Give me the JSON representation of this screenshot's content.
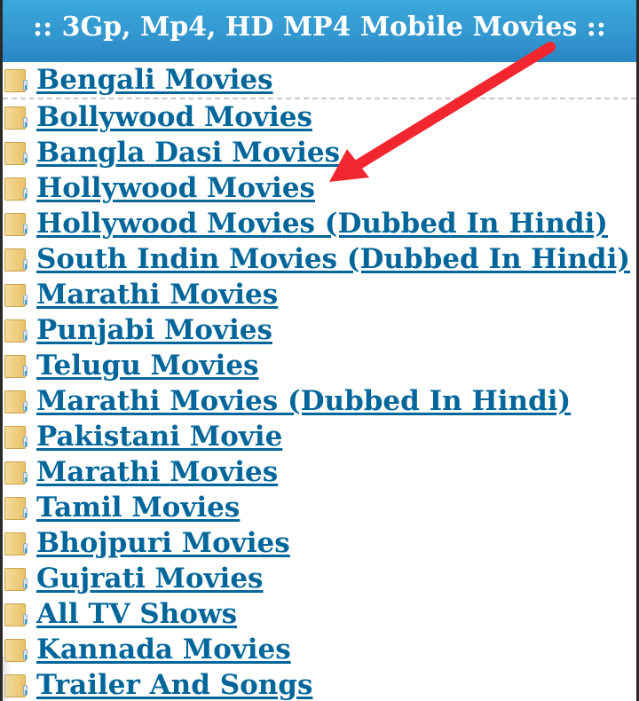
{
  "header": {
    "title": ":: 3Gp, Mp4, HD MP4 Mobile Movies ::"
  },
  "categories": [
    {
      "label": "Bengali Movies",
      "icon": "folder-icon"
    },
    {
      "label": "Bollywood Movies",
      "icon": "folder-icon"
    },
    {
      "label": "Bangla Dasi Movies",
      "icon": "folder-icon"
    },
    {
      "label": "Hollywood Movies",
      "icon": "folder-icon"
    },
    {
      "label": "Hollywood Movies (Dubbed In Hindi)",
      "icon": "folder-icon"
    },
    {
      "label": "South Indin Movies (Dubbed In Hindi)",
      "icon": "folder-icon"
    },
    {
      "label": "Marathi Movies",
      "icon": "folder-icon"
    },
    {
      "label": "Punjabi Movies",
      "icon": "folder-icon"
    },
    {
      "label": "Telugu Movies",
      "icon": "folder-icon"
    },
    {
      "label": "Marathi Movies (Dubbed In Hindi)",
      "icon": "folder-icon"
    },
    {
      "label": "Pakistani Movie",
      "icon": "folder-icon"
    },
    {
      "label": "Marathi Movies",
      "icon": "folder-icon"
    },
    {
      "label": "Tamil Movies",
      "icon": "folder-icon"
    },
    {
      "label": "Bhojpuri Movies",
      "icon": "folder-icon"
    },
    {
      "label": "Gujrati Movies",
      "icon": "folder-icon"
    },
    {
      "label": "All TV Shows",
      "icon": "folder-icon"
    },
    {
      "label": "Kannada Movies",
      "icon": "folder-icon"
    },
    {
      "label": "Trailer And Songs",
      "icon": "folder-icon"
    }
  ],
  "annotation": {
    "type": "red-arrow",
    "points_to": "Hollywood Movies",
    "color": "#f2262e"
  },
  "colors": {
    "header_bg": "#3296cf",
    "link": "#02669a"
  }
}
